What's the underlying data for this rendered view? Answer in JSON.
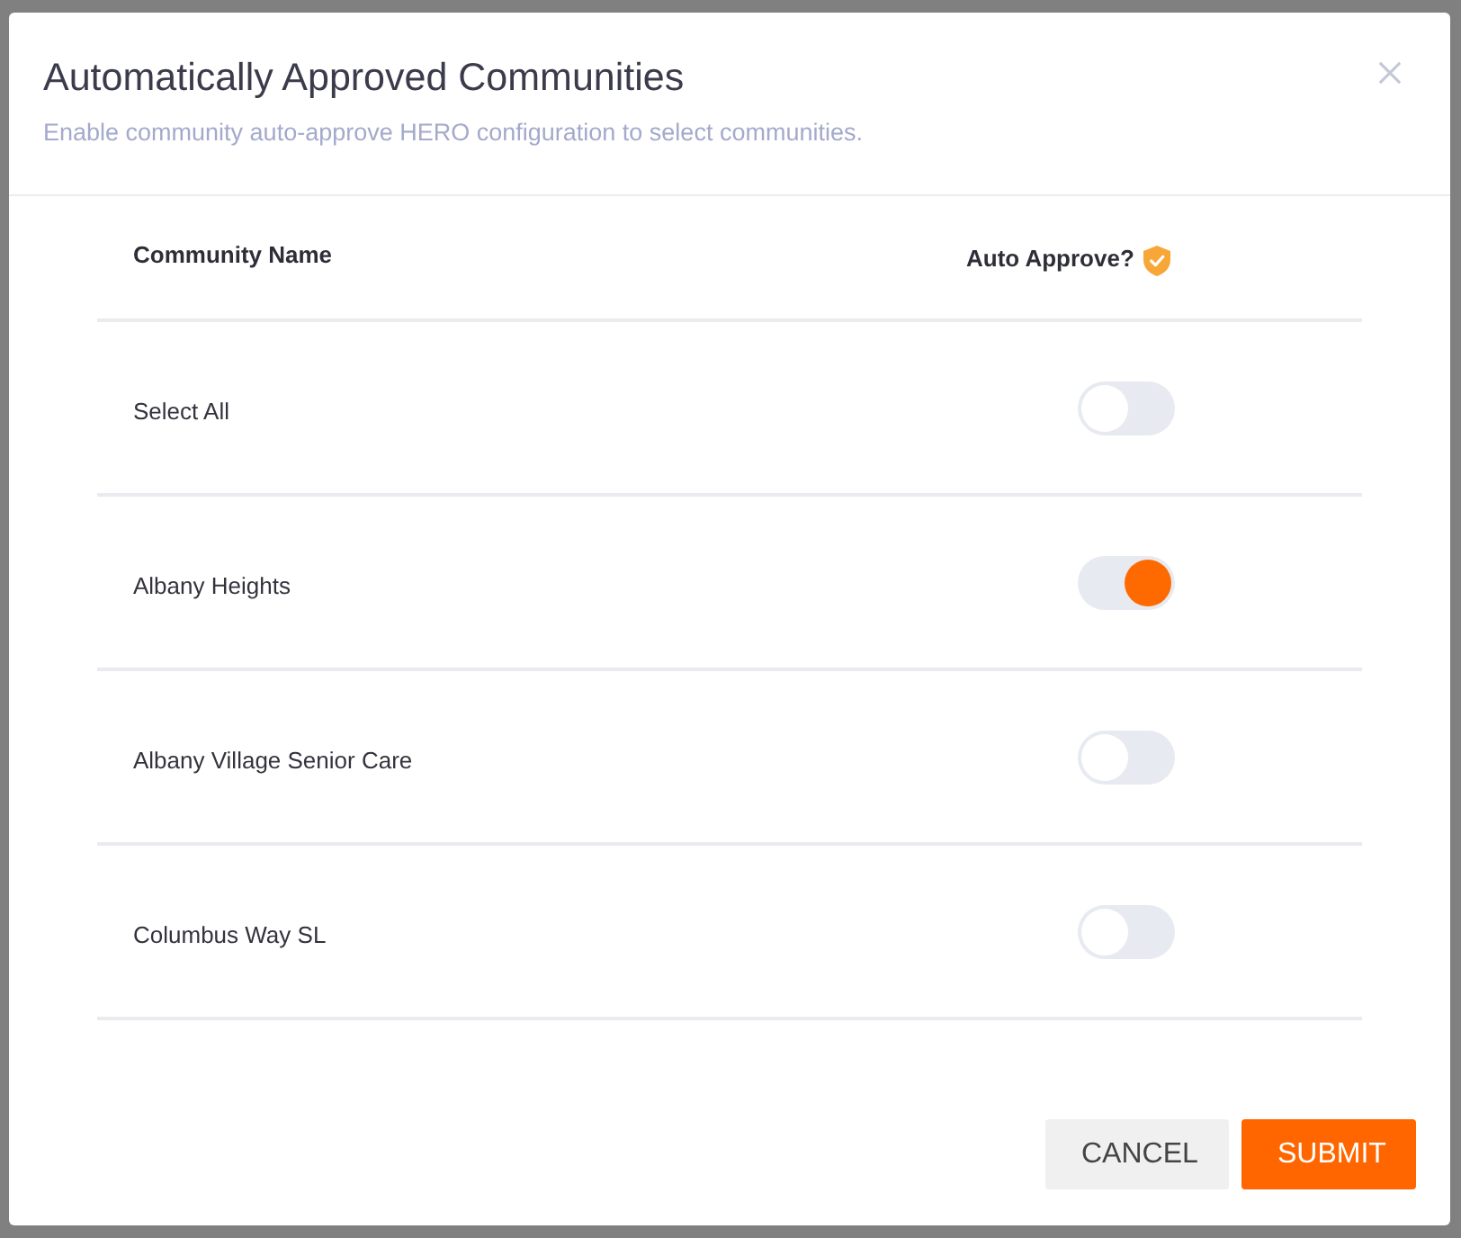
{
  "dialog": {
    "title": "Automatically Approved Communities",
    "subtitle": "Enable community auto-approve HERO configuration to select communities."
  },
  "table": {
    "columns": [
      {
        "label": "Community Name",
        "kind": "text"
      },
      {
        "label": "Auto Approve?",
        "kind": "verified"
      }
    ],
    "rows": [
      {
        "name": "Select All",
        "on": false
      },
      {
        "name": "Albany Heights",
        "on": true
      },
      {
        "name": "Albany Village Senior Care",
        "on": false
      },
      {
        "name": "Columbus Way SL",
        "on": false
      }
    ]
  },
  "buttons": [
    {
      "label": "CANCEL",
      "kind": "secondary"
    },
    {
      "label": "SUBMIT",
      "kind": "primary"
    }
  ]
}
